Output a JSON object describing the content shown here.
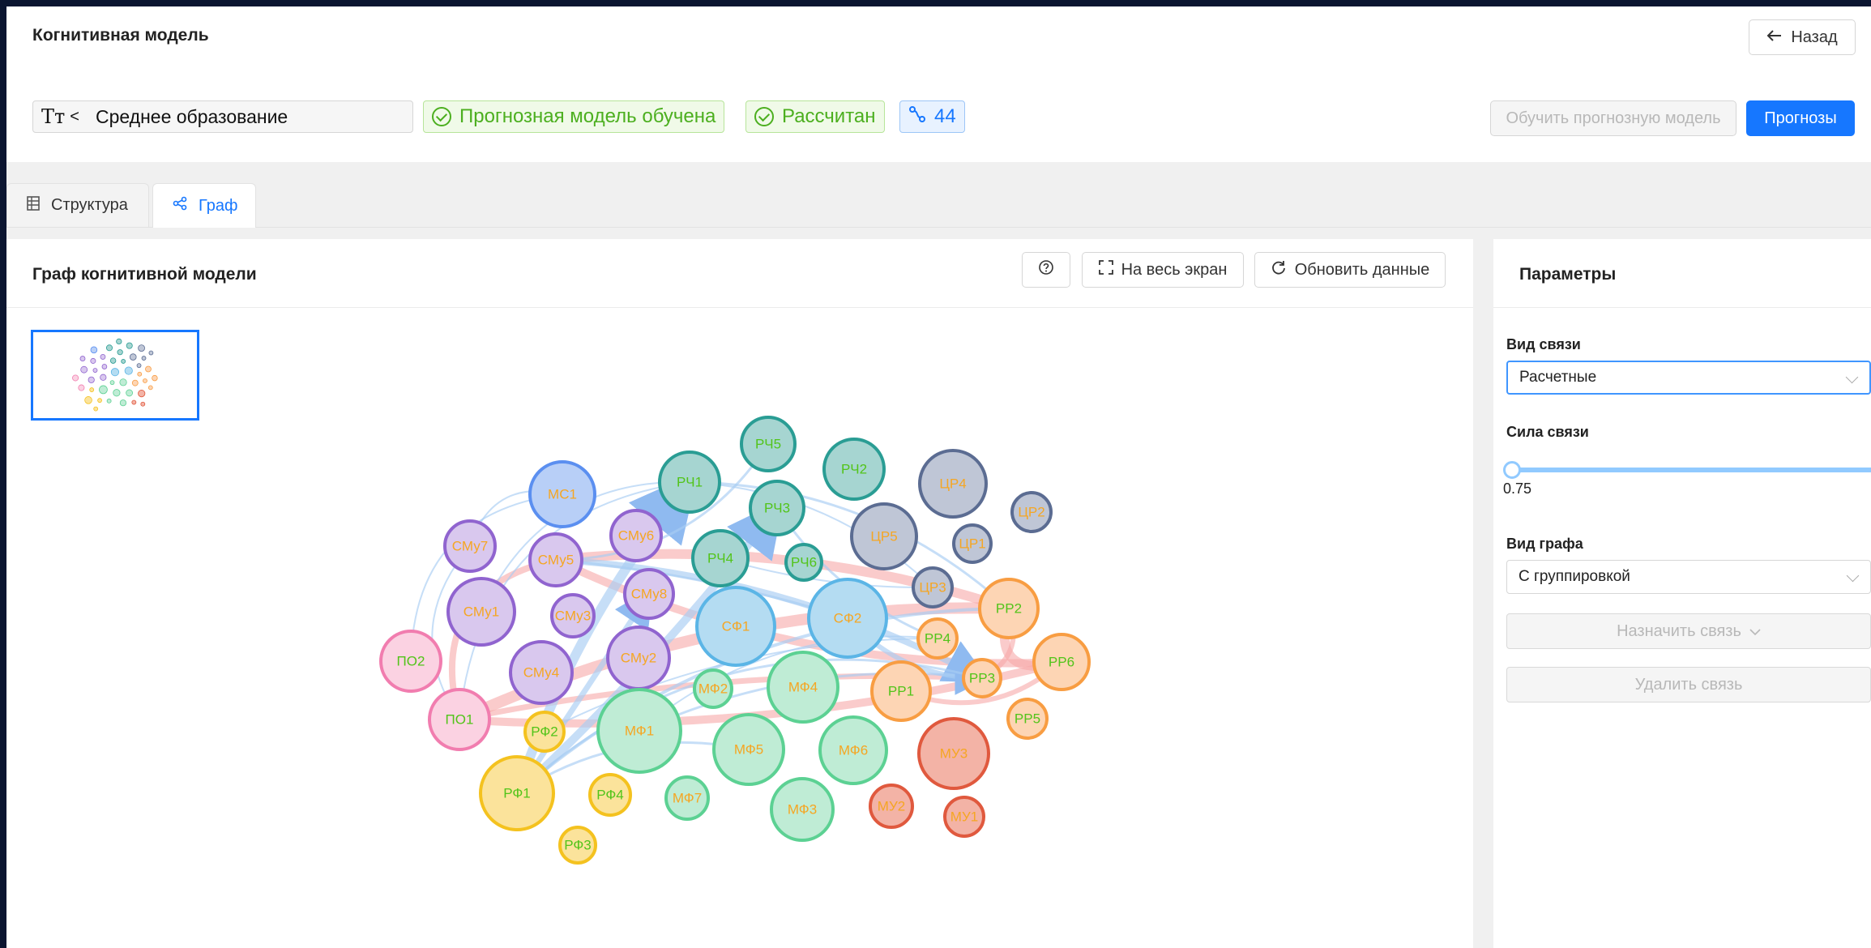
{
  "page": {
    "title": "Когнитивная модель",
    "back_label": "Назад"
  },
  "model": {
    "name": "Среднее образование",
    "status_trained": "Прогнозная модель обучена",
    "status_calculated": "Рассчитан",
    "link_count": "44",
    "train_label": "Обучить прогнозную модель",
    "forecast_label": "Прогнозы"
  },
  "tabs": [
    {
      "label": "Структура",
      "icon": "table-icon",
      "active": false
    },
    {
      "label": "Граф",
      "icon": "share-icon",
      "active": true
    }
  ],
  "graph_card": {
    "title": "Граф когнитивной модели",
    "fullscreen_label": "На весь экран",
    "refresh_label": "Обновить данные"
  },
  "params": {
    "title": "Параметры",
    "link_type_label": "Вид связи",
    "link_type_value": "Расчетные",
    "strength_label": "Сила связи",
    "strength_value": "0.75",
    "graph_type_label": "Вид графа",
    "graph_type_value": "С группировкой",
    "assign_label": "Назначить связь",
    "delete_label": "Удалить связь"
  },
  "colors": {
    "accent": "#1677ff",
    "success": "#52c41a",
    "edge_blue": "#a8ccf2",
    "edge_red": "#f7a8a8"
  },
  "nodes": [
    {
      "id": "РЧ5",
      "group": "teal"
    },
    {
      "id": "РЧ1",
      "group": "teal"
    },
    {
      "id": "РЧ2",
      "group": "teal"
    },
    {
      "id": "РЧ3",
      "group": "teal"
    },
    {
      "id": "РЧ4",
      "group": "teal"
    },
    {
      "id": "РЧ6",
      "group": "teal"
    },
    {
      "id": "МС1",
      "group": "blue"
    },
    {
      "id": "ЦР4",
      "group": "slate"
    },
    {
      "id": "ЦР2",
      "group": "slate"
    },
    {
      "id": "ЦР5",
      "group": "slate"
    },
    {
      "id": "ЦР1",
      "group": "slate"
    },
    {
      "id": "ЦР3",
      "group": "slate"
    },
    {
      "id": "СМу7",
      "group": "purple"
    },
    {
      "id": "СМу5",
      "group": "purple"
    },
    {
      "id": "СМу6",
      "group": "purple"
    },
    {
      "id": "СМу8",
      "group": "purple"
    },
    {
      "id": "СМу1",
      "group": "purple"
    },
    {
      "id": "СМу3",
      "group": "purple"
    },
    {
      "id": "СМу4",
      "group": "purple"
    },
    {
      "id": "СМу2",
      "group": "purple"
    },
    {
      "id": "СФ1",
      "group": "sky"
    },
    {
      "id": "СФ2",
      "group": "sky"
    },
    {
      "id": "РР2",
      "group": "orange"
    },
    {
      "id": "РР4",
      "group": "orange"
    },
    {
      "id": "РР6",
      "group": "orange"
    },
    {
      "id": "РР3",
      "group": "orange"
    },
    {
      "id": "РР1",
      "group": "orange"
    },
    {
      "id": "РР5",
      "group": "orange"
    },
    {
      "id": "ПО2",
      "group": "pink"
    },
    {
      "id": "ПО1",
      "group": "pink"
    },
    {
      "id": "МФ2",
      "group": "green"
    },
    {
      "id": "МФ4",
      "group": "green"
    },
    {
      "id": "МФ1",
      "group": "green"
    },
    {
      "id": "МФ5",
      "group": "green"
    },
    {
      "id": "МФ6",
      "group": "green"
    },
    {
      "id": "МФ7",
      "group": "green"
    },
    {
      "id": "МФ3",
      "group": "green"
    },
    {
      "id": "РФ2",
      "group": "yellow"
    },
    {
      "id": "РФ1",
      "group": "yellow"
    },
    {
      "id": "РФ4",
      "group": "yellow"
    },
    {
      "id": "РФ3",
      "group": "yellow"
    },
    {
      "id": "МУ3",
      "group": "red"
    },
    {
      "id": "МУ2",
      "group": "red"
    },
    {
      "id": "МУ1",
      "group": "red"
    }
  ],
  "groups": {
    "teal": {
      "fill": "#a6d5d1",
      "stroke": "#2a9d94",
      "text": "#52c41a"
    },
    "blue": {
      "fill": "#b8cff7",
      "stroke": "#5b8ff0",
      "text": "#f5a623"
    },
    "slate": {
      "fill": "#bfc6d6",
      "stroke": "#5b6c92",
      "text": "#f5a623"
    },
    "purple": {
      "fill": "#d9c8ee",
      "stroke": "#9064cf",
      "text": "#f5a623"
    },
    "sky": {
      "fill": "#b4dcf2",
      "stroke": "#5bb5e6",
      "text": "#f5a623"
    },
    "orange": {
      "fill": "#fdd5b4",
      "stroke": "#f89d42",
      "text": "#52c41a"
    },
    "pink": {
      "fill": "#fbd2e2",
      "stroke": "#f17daf",
      "text": "#52c41a"
    },
    "green": {
      "fill": "#bfecd5",
      "stroke": "#5cd193",
      "text": "#f5a623"
    },
    "yellow": {
      "fill": "#fbe39b",
      "stroke": "#f4c21f",
      "text": "#52c41a"
    },
    "red": {
      "fill": "#f3b3a6",
      "stroke": "#e0593e",
      "text": "#f5a623"
    }
  }
}
